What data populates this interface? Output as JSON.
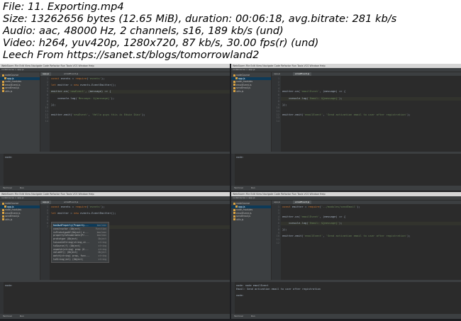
{
  "info": {
    "line1": "File: 11. Exporting.mp4",
    "line2": "Size: 13262656 bytes (12.65 MiB), duration: 00:06:18, avg.bitrate: 281 kb/s",
    "line3": "Audio: aac, 48000 Hz, 2 channels, s16, 189 kb/s (und)",
    "line4": "Video: h264, yuv420p, 1280x720, 87 kb/s, 30.00 fps(r) (und)",
    "line5": "Leech From https://sanet.st/blogs/tomorrowland2"
  },
  "ide": {
    "app_name": "WebStorm",
    "menus": "WebStorm  File  Edit  View  Navigate  Code  Refactor  Run  Tools  VCS  Window  Help",
    "toolbar_path": "nodeCourse > app.js",
    "project_label": "Project",
    "status_terminal": "Terminal",
    "status_run": "Run"
  },
  "thumbs": [
    {
      "tabs": [
        "app.js",
        "emailEvent.js"
      ],
      "sidebar": [
        "nodeCourse",
        "app.js",
        "node_modules",
        "emailEvent.js",
        "sendEmail.js",
        "utils.js"
      ],
      "lines": [
        "1",
        "2",
        "3",
        "4",
        "5",
        "6",
        "7",
        "8",
        "9",
        "10",
        "11",
        "12",
        "13",
        "14"
      ],
      "code": [
        "const events = require('events');",
        "",
        "let emitter = new events.EventEmitter();",
        "",
        "emitter.on('newEvent', (message) => {",
        "",
        "    console.log(`Message: ${message}`);",
        "",
        "});",
        "",
        "",
        "emitter.emit('newEvent', 'Hello guys this is Edwin Diaz');",
        "",
        ""
      ],
      "run": [
        "node:"
      ]
    },
    {
      "tabs": [
        "app.js",
        "emailEvent.js"
      ],
      "sidebar": [
        "nodeCourse",
        "app.js",
        "node_modules",
        "emailEvent.js",
        "sendEmail.js",
        "utils.js"
      ],
      "lines": [
        "1",
        "2",
        "3",
        "4",
        "5",
        "6",
        "7",
        "8",
        "9",
        "10",
        "11",
        "12",
        "13",
        "14"
      ],
      "code": [
        "",
        "",
        "",
        "",
        "emitter.on('emailEvent', (message) => {",
        "",
        "    console.log(`Email: ${message}`);",
        "",
        "});",
        "",
        "",
        "emitter.emit('emailEvent', 'Send activation email to user after registration');",
        "",
        ""
      ],
      "run": [
        "node:"
      ]
    },
    {
      "tabs": [
        "app.js",
        "emailEvent.js"
      ],
      "sidebar": [
        "nodeCourse",
        "app.js",
        "node_modules",
        "emailEvent.js",
        "sendEmail.js",
        "utils.js"
      ],
      "lines": [
        "1",
        "2",
        "3",
        "4",
        "5",
        "6",
        "7"
      ],
      "code": [
        "const events = require('events');",
        "",
        "let emitter = new events.EventEmitter();",
        "",
        "",
        "",
        "module."
      ],
      "autocomplete": [
        {
          "name": "hasOwnProperty(Property...",
          "type": "boolean"
        },
        {
          "name": "constructor (Object)",
          "type": "Function"
        },
        {
          "name": "isPrototypeOf(Object) o...",
          "type": "boolean"
        },
        {
          "name": "propertyIsEnumerable(Pr...",
          "type": "boolean"
        },
        {
          "name": "prototype (Object)",
          "type": "Object"
        },
        {
          "name": "toLocaleString(string,st...",
          "type": "string"
        },
        {
          "name": "toSource(f) (Object)",
          "type": "string"
        },
        {
          "name": "unwatch(string) prop (O...",
          "type": "string"
        },
        {
          "name": "valueOf() (Object)",
          "type": "Object"
        },
        {
          "name": "watch(string) prop, func...",
          "type": "string"
        },
        {
          "name": "toString(int) (Object)",
          "type": "string"
        }
      ],
      "run": [
        "node:"
      ]
    },
    {
      "tabs": [
        "app.js",
        "emailEvent.js"
      ],
      "sidebar": [
        "nodeCourse",
        "app.js",
        "node_modules",
        "emailEvent.js",
        "sendEmail.js",
        "utils.js"
      ],
      "lines": [
        "1",
        "2",
        "3",
        "4",
        "5",
        "6",
        "7",
        "8",
        "9",
        "10",
        "11",
        "12"
      ],
      "code": [
        "const emitter = require('../modules/sendEmail');",
        "",
        "",
        "emitter.on('emailEvent', (message) => {",
        "",
        "    console.log(`Email: ${message}`);",
        "",
        "});",
        "",
        "emitter.emit('emailEvent', 'Send activation email to user after registration');",
        "",
        ""
      ],
      "run": [
        "node: node emailEvent",
        "Email: Send activation email to user after registration",
        "",
        "node:"
      ]
    }
  ]
}
